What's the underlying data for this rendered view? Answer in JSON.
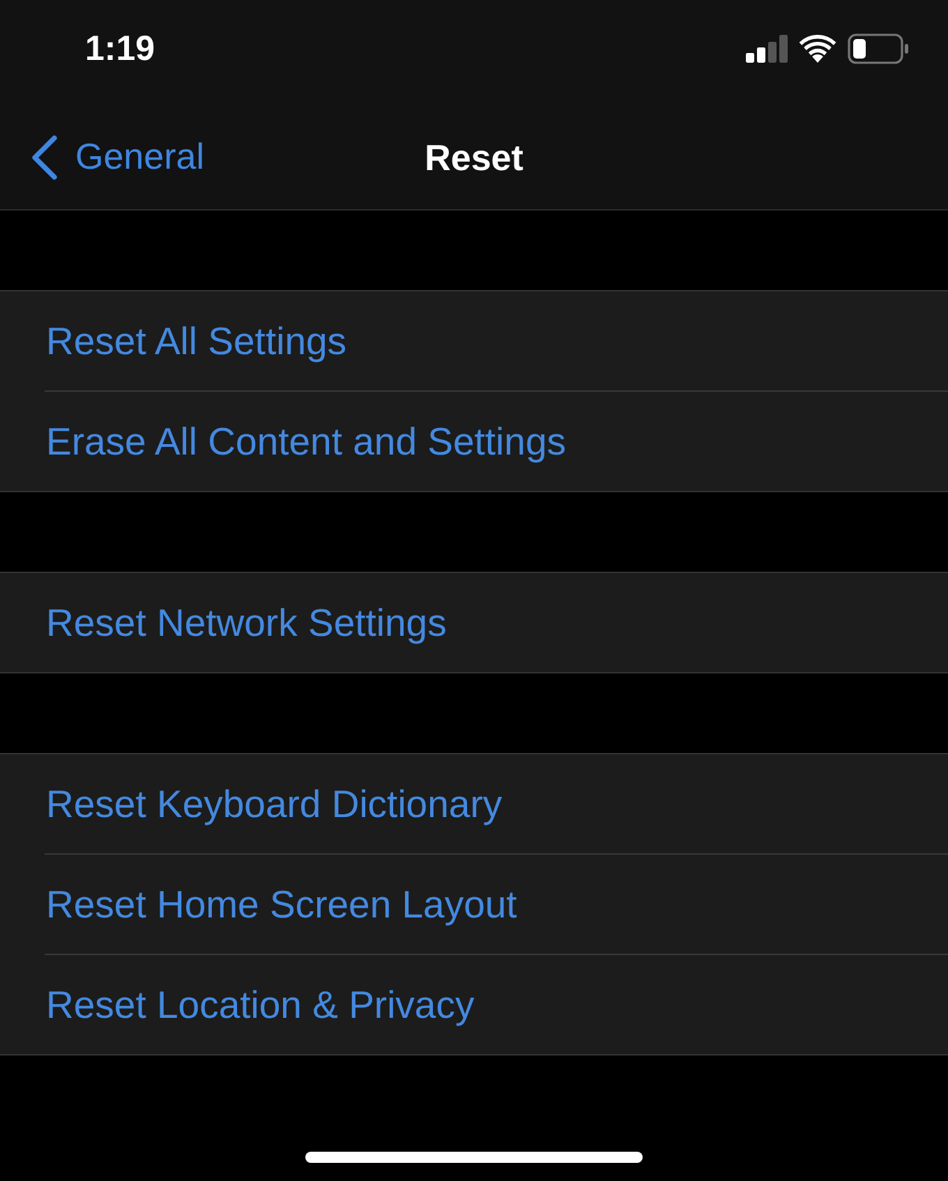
{
  "status_bar": {
    "time": "1:19"
  },
  "nav_bar": {
    "back_label": "General",
    "title": "Reset"
  },
  "groups": [
    [
      "Reset All Settings",
      "Erase All Content and Settings"
    ],
    [
      "Reset Network Settings"
    ],
    [
      "Reset Keyboard Dictionary",
      "Reset Home Screen Layout",
      "Reset Location & Privacy"
    ]
  ]
}
